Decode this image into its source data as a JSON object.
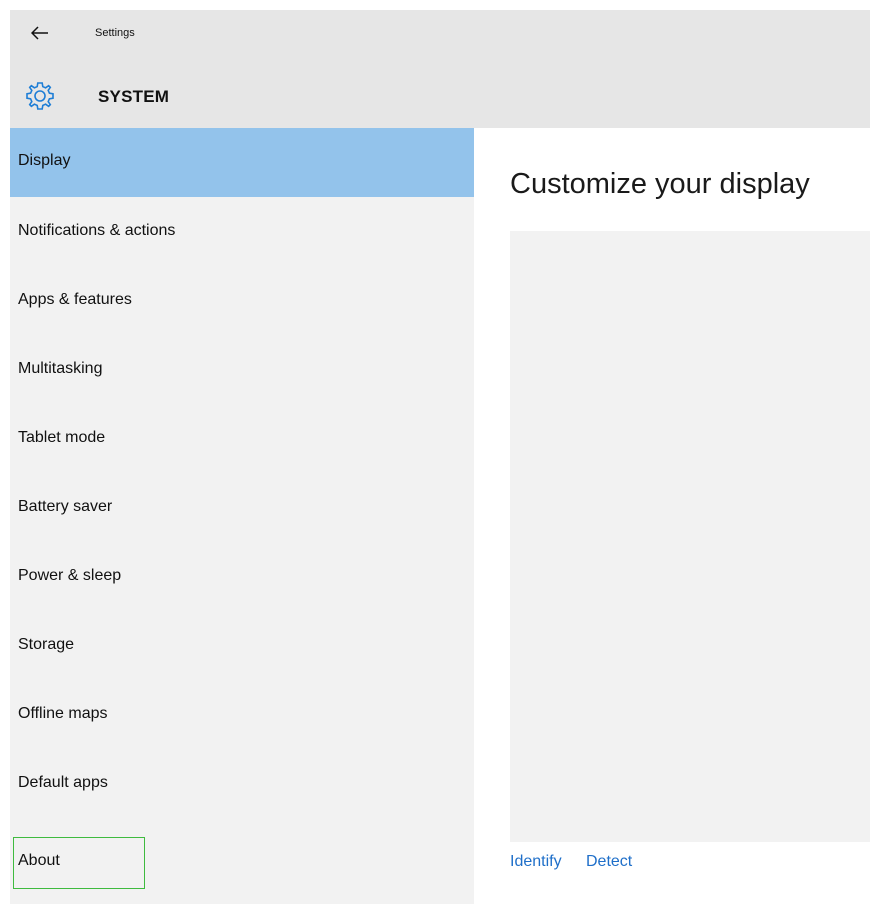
{
  "header": {
    "back_icon": "back-arrow-icon",
    "app_title": "Settings",
    "section_icon": "gear-icon",
    "section_title": "SYSTEM",
    "accent_color": "#1e7ed6"
  },
  "sidebar": {
    "selected_color": "#93c3eb",
    "items": [
      {
        "label": "Display"
      },
      {
        "label": "Notifications & actions"
      },
      {
        "label": "Apps & features"
      },
      {
        "label": "Multitasking"
      },
      {
        "label": "Tablet mode"
      },
      {
        "label": "Battery saver"
      },
      {
        "label": "Power & sleep"
      },
      {
        "label": "Storage"
      },
      {
        "label": "Offline maps"
      },
      {
        "label": "Default apps"
      },
      {
        "label": "About"
      }
    ]
  },
  "main": {
    "title": "Customize your display",
    "links": {
      "identify": "Identify",
      "detect": "Detect"
    },
    "link_color": "#1f6fc9"
  }
}
